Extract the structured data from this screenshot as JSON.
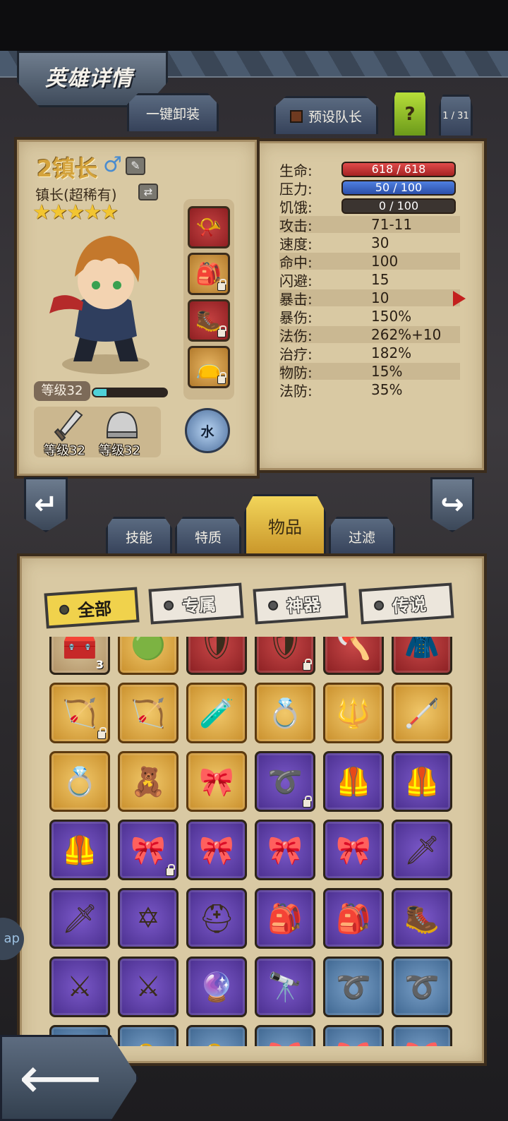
{
  "header": {
    "title": "英雄详情"
  },
  "top_buttons": {
    "unequip_all": "一键卸装",
    "preset_leader": "预设队长",
    "help": "?",
    "page_counter": "1 / 31"
  },
  "hero": {
    "name": "2镇长",
    "gender_symbol": "♂",
    "class": "镇长(超稀有)",
    "stars": "★★★★★",
    "star_count": 5,
    "level": "等级32",
    "xp_fraction": 0.18,
    "weapon_level": "等级32",
    "armor_level": "等级32",
    "element": "水",
    "slots": [
      {
        "icon": "horn-icon",
        "rarity": "red",
        "locked": false
      },
      {
        "icon": "backpack-icon",
        "rarity": "gold",
        "locked": true
      },
      {
        "icon": "winged-boots-icon",
        "rarity": "red",
        "locked": true
      },
      {
        "icon": "pouch-icon",
        "rarity": "gold",
        "locked": true
      }
    ]
  },
  "stats": {
    "hp": {
      "label": "生命:",
      "value": "618 / 618",
      "fraction": 1.0
    },
    "stress": {
      "label": "压力:",
      "value": "50 / 100",
      "fraction": 0.5
    },
    "hunger": {
      "label": "饥饿:",
      "value": "0 / 100",
      "fraction": 0.0
    },
    "rows": [
      {
        "label": "攻击:",
        "value": "71-11"
      },
      {
        "label": "速度:",
        "value": "30"
      },
      {
        "label": "命中:",
        "value": "100"
      },
      {
        "label": "闪避:",
        "value": "15"
      },
      {
        "label": "暴击:",
        "value": "10"
      },
      {
        "label": "暴伤:",
        "value": "150%"
      },
      {
        "label": "法伤:",
        "value": "262%+10"
      },
      {
        "label": "治疗:",
        "value": "182%"
      },
      {
        "label": "物防:",
        "value": "15%"
      },
      {
        "label": "法防:",
        "value": "35%"
      }
    ]
  },
  "section_tabs": {
    "skills": "技能",
    "traits": "特质",
    "items": "物品",
    "filter": "过滤"
  },
  "category_tabs": {
    "all": "全部",
    "exclusive": "专属",
    "artifact": "神器",
    "legendary": "传说"
  },
  "inventory_rows": [
    [
      {
        "icon": "chest-icon",
        "rarity": "common",
        "qty": "3"
      },
      {
        "icon": "green-orb-icon",
        "rarity": "rare",
        "qty": ""
      },
      {
        "icon": "armor-figure-icon",
        "rarity": "red",
        "qty": ""
      },
      {
        "icon": "laurel-shield-icon",
        "rarity": "red",
        "qty": "",
        "locked": true
      },
      {
        "icon": "axe-icon",
        "rarity": "red",
        "qty": ""
      },
      {
        "icon": "cape-icon",
        "rarity": "red",
        "qty": ""
      }
    ],
    [
      {
        "icon": "crossbow-icon",
        "rarity": "rare",
        "qty": "",
        "locked": true
      },
      {
        "icon": "bow-icon",
        "rarity": "rare",
        "qty": ""
      },
      {
        "icon": "potion-icon",
        "rarity": "rare",
        "qty": ""
      },
      {
        "icon": "ruby-ring-icon",
        "rarity": "rare",
        "qty": ""
      },
      {
        "icon": "scepter-icon",
        "rarity": "rare",
        "qty": ""
      },
      {
        "icon": "staff-icon",
        "rarity": "rare",
        "qty": ""
      }
    ],
    [
      {
        "icon": "jade-ring-icon",
        "rarity": "rare",
        "qty": ""
      },
      {
        "icon": "voodoo-doll-icon",
        "rarity": "rare",
        "qty": ""
      },
      {
        "icon": "red-belt-icon",
        "rarity": "rare",
        "qty": ""
      },
      {
        "icon": "whip-icon",
        "rarity": "purple",
        "qty": "",
        "locked": true
      },
      {
        "icon": "dark-armor-icon",
        "rarity": "purple",
        "qty": ""
      },
      {
        "icon": "dark-armor-icon",
        "rarity": "purple",
        "qty": ""
      }
    ],
    [
      {
        "icon": "dark-armor-icon",
        "rarity": "purple",
        "qty": ""
      },
      {
        "icon": "red-belt-icon",
        "rarity": "purple",
        "qty": "",
        "locked": true
      },
      {
        "icon": "red-belt-icon",
        "rarity": "purple",
        "qty": ""
      },
      {
        "icon": "red-belt-icon",
        "rarity": "purple",
        "qty": ""
      },
      {
        "icon": "red-belt-icon",
        "rarity": "purple",
        "qty": ""
      },
      {
        "icon": "ice-sword-icon",
        "rarity": "purple",
        "qty": ""
      }
    ],
    [
      {
        "icon": "ice-sword-icon",
        "rarity": "purple",
        "qty": ""
      },
      {
        "icon": "pentagram-icon",
        "rarity": "purple",
        "qty": ""
      },
      {
        "icon": "helmet-icon",
        "rarity": "purple",
        "qty": ""
      },
      {
        "icon": "backpack-icon",
        "rarity": "purple",
        "qty": ""
      },
      {
        "icon": "backpack-icon",
        "rarity": "purple",
        "qty": ""
      },
      {
        "icon": "winged-boots-icon",
        "rarity": "purple",
        "qty": ""
      }
    ],
    [
      {
        "icon": "scimitar-icon",
        "rarity": "purple",
        "qty": ""
      },
      {
        "icon": "scimitar-icon",
        "rarity": "purple",
        "qty": ""
      },
      {
        "icon": "crystal-wand-icon",
        "rarity": "purple",
        "qty": ""
      },
      {
        "icon": "spyglass-icon",
        "rarity": "purple",
        "qty": ""
      },
      {
        "icon": "whip-icon",
        "rarity": "blue",
        "qty": ""
      },
      {
        "icon": "whip-icon",
        "rarity": "blue",
        "qty": ""
      }
    ],
    [
      {
        "icon": "red-belt-icon",
        "rarity": "blue",
        "qty": ""
      },
      {
        "icon": "horn-icon",
        "rarity": "blue",
        "qty": ""
      },
      {
        "icon": "horn-icon",
        "rarity": "blue",
        "qty": ""
      },
      {
        "icon": "red-belt-icon",
        "rarity": "blue",
        "qty": ""
      },
      {
        "icon": "red-belt-icon",
        "rarity": "blue",
        "qty": ""
      },
      {
        "icon": "red-belt-icon",
        "rarity": "blue",
        "qty": ""
      }
    ]
  ],
  "side_bubble": "ap",
  "colors": {
    "accent_gold": "#f0d24c",
    "panel": "#d9c9a3",
    "hp": "#c83434",
    "stress": "#3f6ac8"
  }
}
